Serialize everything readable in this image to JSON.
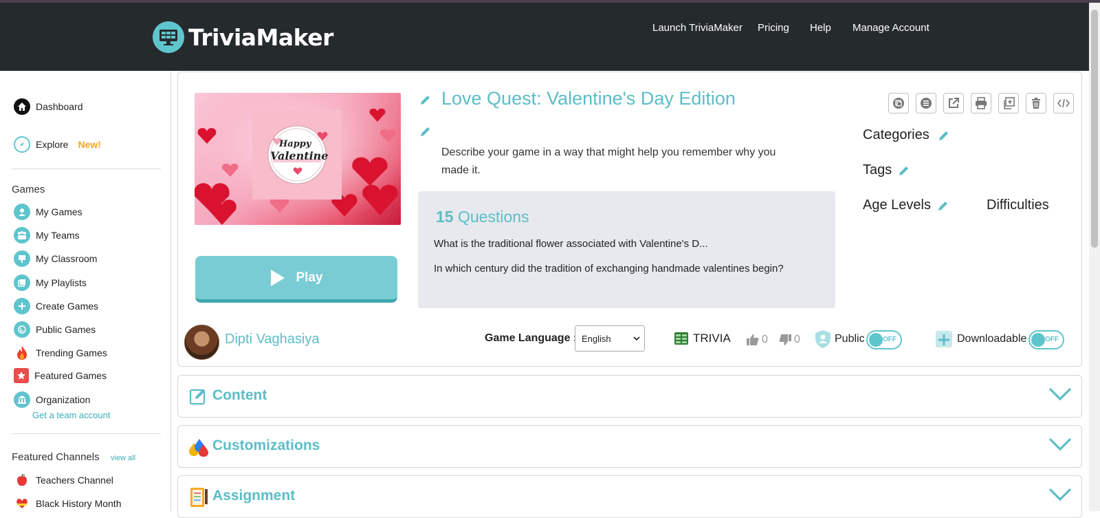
{
  "header": {
    "logo_text": "TriviaMaker",
    "nav": [
      "Launch TriviaMaker",
      "Pricing",
      "Help",
      "Manage Account"
    ]
  },
  "sidebar": {
    "dashboard": "Dashboard",
    "explore": "Explore",
    "explore_badge": "New!",
    "games_heading": "Games",
    "games_items": [
      "My Games",
      "My Teams",
      "My Classroom",
      "My Playlists",
      "Create Games",
      "Public Games",
      "Trending Games",
      "Featured Games",
      "Organization"
    ],
    "team_account_link": "Get a team account",
    "channels_heading": "Featured Channels",
    "view_all": "view all",
    "channels": [
      "Teachers Channel",
      "Black History Month"
    ]
  },
  "game": {
    "title": "Love Quest: Valentine's Day Edition",
    "description": "Describe your game in a way that might help you remember why you made it.",
    "thumbnail_text_1": "Happy",
    "thumbnail_text_2": "Valentine",
    "play_label": "Play",
    "question_count": "15",
    "questions_label": "Questions",
    "questions": [
      "What is the traditional flower associated with Valentine's D...",
      "In which century did the tradition of exchanging handmade valentines begin?"
    ],
    "categories_label": "Categories",
    "tags_label": "Tags",
    "age_levels_label": "Age Levels",
    "difficulties_label": "Difficulties",
    "toolbar_icons": [
      "copy-icon",
      "list-icon",
      "external-link-icon",
      "print-icon",
      "duplicate-icon",
      "trash-icon",
      "embed-code-icon"
    ]
  },
  "author": {
    "name": "Dipti Vaghasiya"
  },
  "settings": {
    "language_label": "Game Language :",
    "language_value": "English",
    "game_type": "TRIVIA",
    "likes": "0",
    "dislikes": "0",
    "public_label": "Public",
    "public_toggle": "OFF",
    "downloadable_label": "Downloadable",
    "downloadable_toggle": "OFF"
  },
  "sections": [
    "Content",
    "Customizations",
    "Assignment"
  ],
  "colors": {
    "accent": "#5cbdc6",
    "header_bg": "#252a2d",
    "explore_badge": "#f5a623"
  }
}
